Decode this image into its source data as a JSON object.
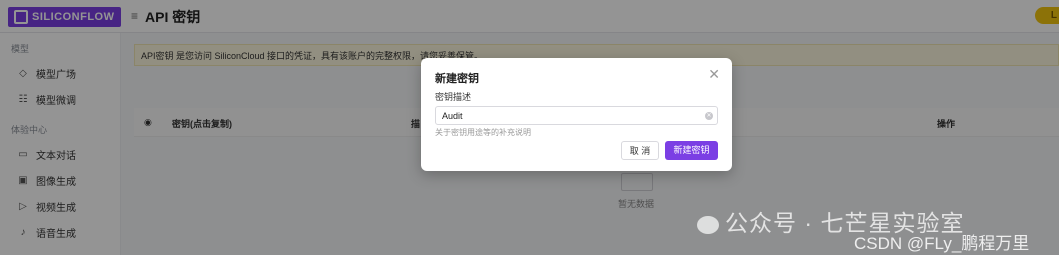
{
  "header": {
    "logo_text": "SILICONFLOW",
    "menu_icon": "hamburger-icon",
    "title": "API 密钥",
    "corner_badge": "L"
  },
  "sidebar": {
    "groups": [
      {
        "label": "模型",
        "items": [
          {
            "label": "模型广场",
            "icon": "cube-icon"
          },
          {
            "label": "模型微调",
            "icon": "tune-icon"
          }
        ]
      },
      {
        "label": "体验中心",
        "items": [
          {
            "label": "文本对话",
            "icon": "chat-icon"
          },
          {
            "label": "图像生成",
            "icon": "image-icon"
          },
          {
            "label": "视频生成",
            "icon": "video-icon"
          },
          {
            "label": "语音生成",
            "icon": "mic-icon"
          }
        ]
      }
    ]
  },
  "main": {
    "notice": "API密钥 是您访问 SiliconCloud 接口的凭证，具有该账户的完整权限，请您妥善保管。",
    "table": {
      "columns": [
        "密钥(点击复制)",
        "描",
        "操作"
      ]
    },
    "empty_text": "暂无数据"
  },
  "modal": {
    "title": "新建密钥",
    "field_label": "密钥描述",
    "field_value": "Audit",
    "field_hint": "关于密钥用途等的补充说明",
    "cancel_label": "取 消",
    "create_label": "新建密钥"
  },
  "watermarks": {
    "wechat": "公众号 · 七芒星实验室",
    "csdn": "CSDN @FLy_鹏程万里"
  },
  "colors": {
    "brand": "#7b3fe4",
    "notice_bg": "#fcf7df"
  }
}
